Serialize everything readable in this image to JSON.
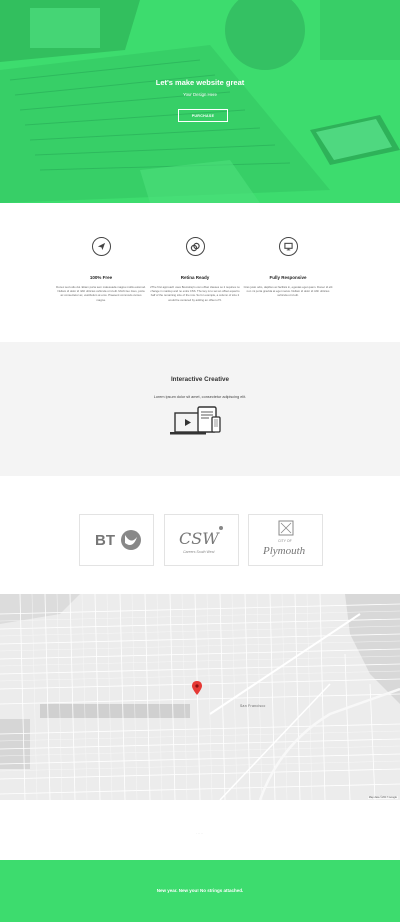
{
  "hero": {
    "title": "Let's make website great",
    "subtitle": "Your Design Here",
    "button_label": "PURCHASE"
  },
  "features": [
    {
      "icon": "paper-plane-icon",
      "title": "100% Free",
      "text": "Donec sed odio dui. Etiam porta sem malesuada magna mollis euismod. Nullam id dolor id nibh ultricies vehicula ut id elit. Morbi leo risus, porta ac consectetur ac, vestibulum at eros. Praesent commodo cursus magna."
    },
    {
      "icon": "rings-icon",
      "title": "Retina Ready",
      "text": "2The first approach uses Bootstrap's own offset classes so it requires no change in markup and no extra CSS. The key is to set an offset equal to half of the remaining size of the row. So for example, a column of size 2 would be centered by adding an offset of 5."
    },
    {
      "icon": "monitor-icon",
      "title": "Fully Responsive",
      "text": "Cras justo odio, dapibus ac facilisis in, egestas eget quam. Donec id elit non mi porta gravida at eget metus. Nullam id dolor id nibh ultricies vehicula ut id elit."
    }
  ],
  "creative": {
    "title": "Interactive Creative",
    "text": "Lorem ipsum dolor sit amet, consectetur adipiscing elit."
  },
  "logos": [
    {
      "name": "bt-logo",
      "text": "BT"
    },
    {
      "name": "csw-logo",
      "text": "CSW",
      "sub": "Careers South West"
    },
    {
      "name": "plymouth-logo",
      "text": "Plymouth",
      "pre": "CITY OF"
    }
  ],
  "map": {
    "city_label": "San Francisco",
    "attribution": "Map data ©2017 Google"
  },
  "footer": {
    "dots": "·····"
  },
  "banner": {
    "text": "New year. New you! No strings attached."
  },
  "colors": {
    "accent": "#3ddc6e",
    "light_bg": "#f4f4f4"
  }
}
